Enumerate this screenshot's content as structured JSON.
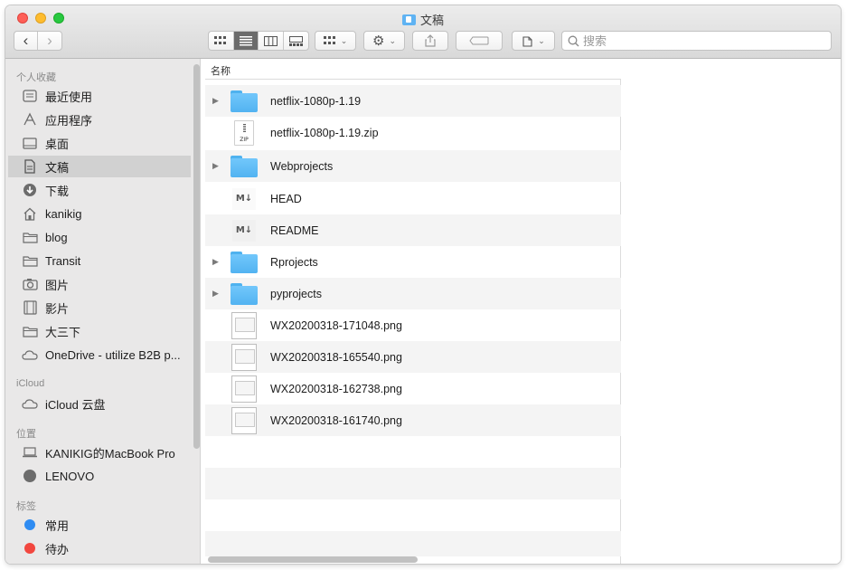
{
  "window": {
    "title": "文稿"
  },
  "toolbar": {
    "back": "‹",
    "forward": "›",
    "search_placeholder": "搜索"
  },
  "sidebar": {
    "sections": [
      {
        "label": "个人收藏"
      },
      {
        "label": "iCloud"
      },
      {
        "label": "位置"
      },
      {
        "label": "标签"
      }
    ],
    "favorites": [
      {
        "label": "最近使用",
        "icon": "clock-icon"
      },
      {
        "label": "应用程序",
        "icon": "apps-icon"
      },
      {
        "label": "桌面",
        "icon": "desktop-icon"
      },
      {
        "label": "文稿",
        "icon": "document-icon",
        "selected": true
      },
      {
        "label": "下载",
        "icon": "download-icon"
      },
      {
        "label": "kanikig",
        "icon": "home-icon"
      },
      {
        "label": "blog",
        "icon": "folder-icon"
      },
      {
        "label": "Transit",
        "icon": "folder-icon"
      },
      {
        "label": "图片",
        "icon": "camera-icon"
      },
      {
        "label": "影片",
        "icon": "film-icon"
      },
      {
        "label": "大三下",
        "icon": "folder-icon"
      },
      {
        "label": "OneDrive - utilize B2B p...",
        "icon": "cloud-icon"
      }
    ],
    "icloud": [
      {
        "label": "iCloud 云盘",
        "icon": "cloud-icon"
      }
    ],
    "locations": [
      {
        "label": "KANIKIG的MacBook Pro",
        "icon": "laptop-icon"
      },
      {
        "label": "LENOVO",
        "icon": "disk-icon"
      }
    ],
    "tags": [
      {
        "label": "常用",
        "color": "#2f8cf2"
      },
      {
        "label": "待办",
        "color": "#f2473f"
      }
    ]
  },
  "list": {
    "column_header": "名称",
    "rows": [
      {
        "name": "netflix-1080p-1.19",
        "type": "folder",
        "expandable": true
      },
      {
        "name": "netflix-1080p-1.19.zip",
        "type": "zip",
        "expandable": false,
        "icon_label": "ZIP"
      },
      {
        "name": "Webprojects",
        "type": "folder",
        "expandable": true
      },
      {
        "name": "HEAD",
        "type": "markdown",
        "expandable": false,
        "icon_label": "M↓"
      },
      {
        "name": "README",
        "type": "markdown",
        "expandable": false,
        "icon_label": "M↓"
      },
      {
        "name": "Rprojects",
        "type": "folder",
        "expandable": true
      },
      {
        "name": "pyprojects",
        "type": "folder",
        "expandable": true
      },
      {
        "name": "WX20200318-171048.png",
        "type": "png",
        "expandable": false
      },
      {
        "name": "WX20200318-165540.png",
        "type": "png",
        "expandable": false
      },
      {
        "name": "WX20200318-162738.png",
        "type": "png",
        "expandable": false
      },
      {
        "name": "WX20200318-161740.png",
        "type": "png",
        "expandable": false
      }
    ]
  },
  "colors": {
    "folder": "#5ab6f2",
    "selection": "#d1d1d1",
    "close": "#fe5f57",
    "minimize": "#febc2e",
    "maximize": "#28c840"
  }
}
